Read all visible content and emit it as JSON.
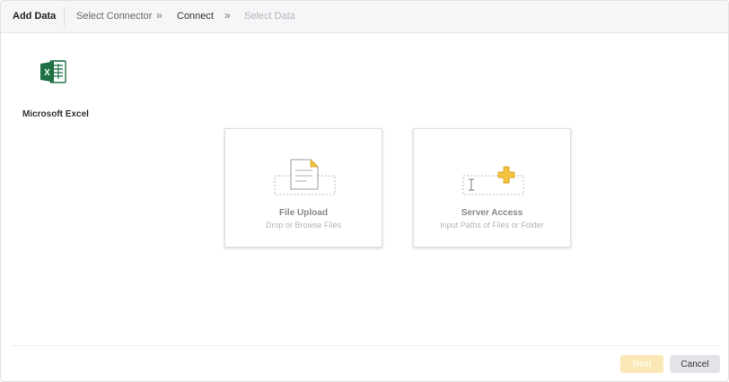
{
  "header": {
    "title": "Add Data",
    "steps": [
      "Select Connector",
      "Connect",
      "Select Data"
    ],
    "separator": "»"
  },
  "connector": {
    "name": "Microsoft Excel",
    "icon": "excel-icon",
    "brand_color": "#1f7244"
  },
  "cards": [
    {
      "title": "File Upload",
      "subtitle": "Drop or Browse Files",
      "icon": "file-upload-icon"
    },
    {
      "title": "Server Access",
      "subtitle": "Input Paths of Files or Folder",
      "icon": "server-access-icon"
    }
  ],
  "footer": {
    "next_label": "Next",
    "cancel_label": "Cancel"
  },
  "colors": {
    "accent": "#f5c33b",
    "next_disabled": "#fbe7b5"
  }
}
